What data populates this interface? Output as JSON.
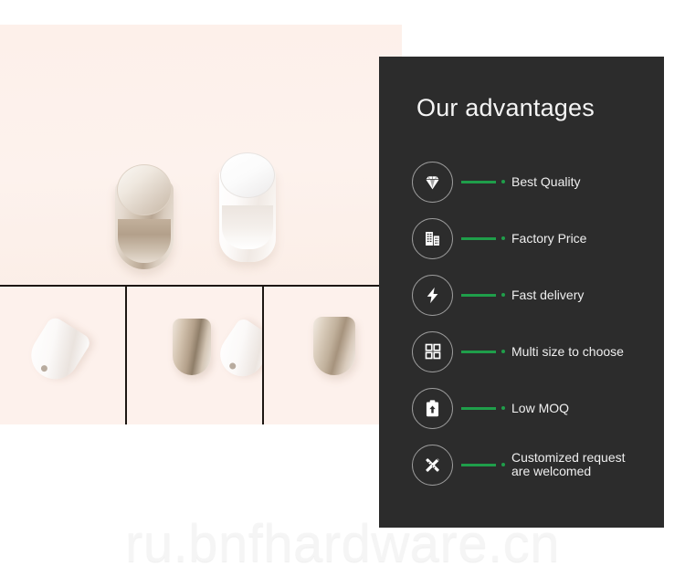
{
  "panel": {
    "title": "Our advantages",
    "background_color": "#2c2c2c",
    "accent_color": "#1f9e4a",
    "text_color": "#efefef",
    "items": [
      {
        "icon": "diamond-icon",
        "label": "Best Quality"
      },
      {
        "icon": "factory-building-icon",
        "label": "Factory Price"
      },
      {
        "icon": "lightning-bolt-icon",
        "label": "Fast delivery"
      },
      {
        "icon": "grid-squares-icon",
        "label": "Multi size to choose"
      },
      {
        "icon": "clipboard-upload-icon",
        "label": "Low MOQ"
      },
      {
        "icon": "pencil-ruler-icon",
        "label": "Customized request\nare welcomed"
      }
    ]
  },
  "product_photos": {
    "background_color": "#fdf1ec",
    "hero": {
      "name": "cabinet-knobs-pair-photo",
      "items": [
        "brushed-nickel-knob",
        "white-knob"
      ]
    },
    "thumbnails": [
      {
        "name": "white-knob-angled-photo"
      },
      {
        "name": "nickel-and-white-knobs-photo"
      },
      {
        "name": "nickel-knob-photo"
      }
    ]
  },
  "watermark": {
    "text": "ru.bnfhardware.cn"
  }
}
